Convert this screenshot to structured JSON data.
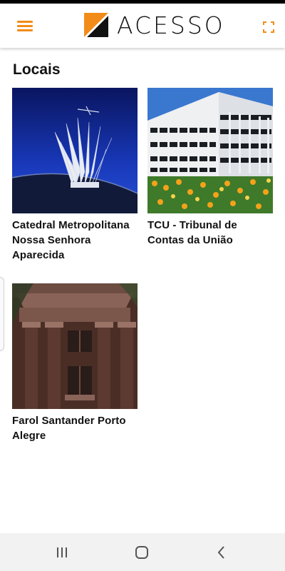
{
  "header": {
    "brand": "ACESSO",
    "accent_color": "#f28c18",
    "menu_icon": "hamburger-menu-icon",
    "fullscreen_icon": "fullscreen-icon"
  },
  "page": {
    "title": "Locais"
  },
  "places": [
    {
      "name": "Catedral Metropolitana Nossa Senhora Aparecida",
      "image": "cathedral-photo"
    },
    {
      "name": "TCU - Tribunal de Contas da União",
      "image": "tcu-building-photo"
    },
    {
      "name": "Farol Santander Porto Alegre",
      "image": "farol-santander-photo"
    }
  ],
  "system_nav": {
    "recents_icon": "recents-icon",
    "home_icon": "home-icon",
    "back_icon": "back-icon"
  }
}
